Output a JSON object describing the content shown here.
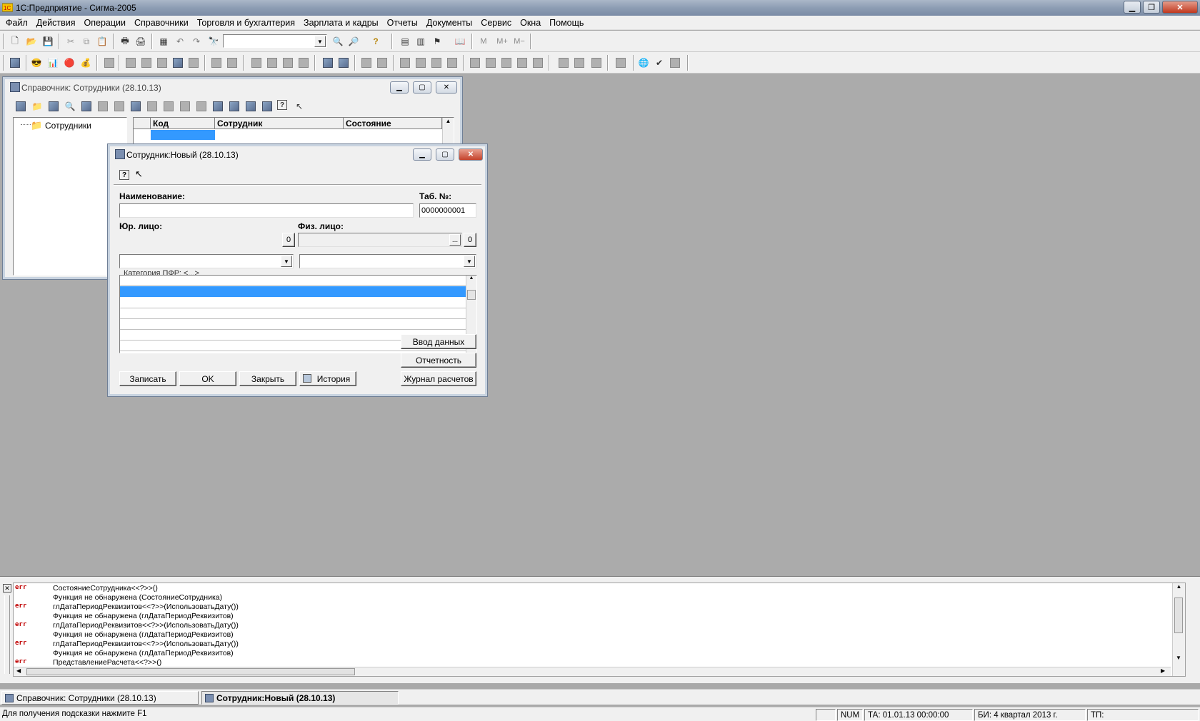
{
  "app": {
    "title": "1С:Предприятие - Сигма-2005"
  },
  "menu": [
    "Файл",
    "Действия",
    "Операции",
    "Справочники",
    "Торговля и бухгалтерия",
    "Зарплата и кадры",
    "Отчеты",
    "Документы",
    "Сервис",
    "Окна",
    "Помощь"
  ],
  "toolbar": {
    "memory_buttons": [
      "M",
      "M+",
      "M−"
    ]
  },
  "directory_window": {
    "title": "Справочник: Сотрудники (28.10.13)",
    "tree_root": "Сотрудники",
    "columns": [
      "Код",
      "Сотрудник",
      "Состояние"
    ]
  },
  "employee_form": {
    "title": "Сотрудник:Новый (28.10.13)",
    "name_label": "Наименование:",
    "name_value": "",
    "tab_label": "Таб. №:",
    "tab_value": "0000000001",
    "legal_label": "Юр. лицо:",
    "person_label": "Физ. лицо:",
    "counter_left": "0",
    "counter_right": "0",
    "ellipsis": "...",
    "category_label": "Категория ПФР: <...>",
    "btn_data_entry": "Ввод данных",
    "btn_reporting": "Отчетность",
    "btn_calc_journal": "Журнал расчетов",
    "btn_save": "Записать",
    "btn_ok": "OK",
    "btn_close": "Закрыть",
    "btn_history": "История"
  },
  "messages": [
    {
      "tag": "err",
      "text": "СостояниеСотрудника<<?>>()"
    },
    {
      "tag": "",
      "text": "Функция не обнаружена (СостояниеСотрудника)"
    },
    {
      "tag": "err",
      "text": "глДатаПериодРеквизитов<<?>>(ИспользоватьДату())"
    },
    {
      "tag": "",
      "text": "Функция не обнаружена (глДатаПериодРеквизитов)"
    },
    {
      "tag": "err",
      "text": "глДатаПериодРеквизитов<<?>>(ИспользоватьДату())"
    },
    {
      "tag": "",
      "text": "Функция не обнаружена (глДатаПериодРеквизитов)"
    },
    {
      "tag": "err",
      "text": "глДатаПериодРеквизитов<<?>>(ИспользоватьДату())"
    },
    {
      "tag": "",
      "text": "Функция не обнаружена (глДатаПериодРеквизитов)"
    },
    {
      "tag": "err",
      "text": "ПредставлениеРасчета<<?>>()"
    }
  ],
  "tasks": [
    "Справочник: Сотрудники (28.10.13)",
    "Сотрудник:Новый (28.10.13)"
  ],
  "status": {
    "hint": "Для получения подсказки нажмите F1",
    "num": "NUM",
    "ta": "ТА: 01.01.13  00:00:00",
    "bi": "БИ: 4 квартал 2013 г.",
    "tp": "ТП:"
  },
  "colors": {
    "selection": "#3399ff",
    "error_tag": "#c00000"
  }
}
